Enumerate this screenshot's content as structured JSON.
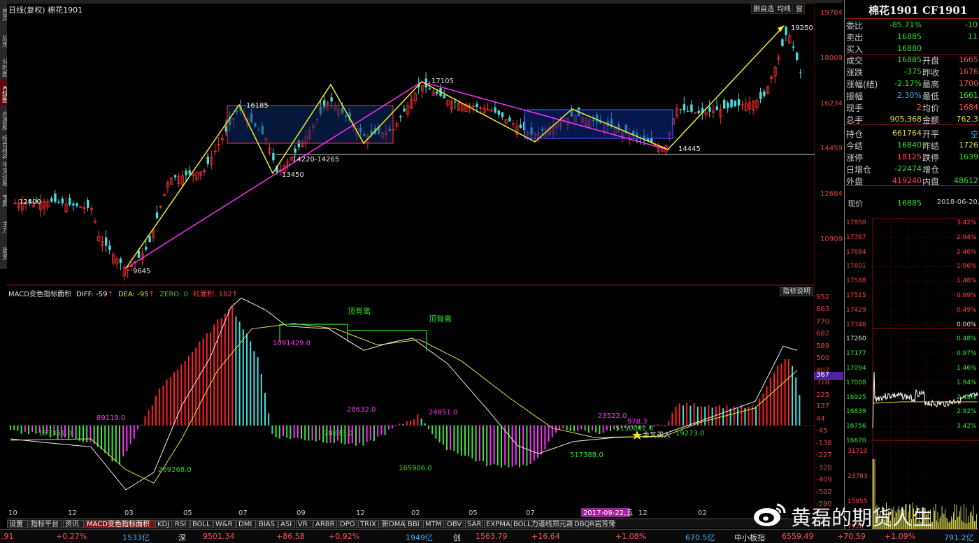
{
  "main_chart": {
    "title": "日线(复权) 棉花1901",
    "toolbar": {
      "btn1": "删自选",
      "btn2": "均线",
      "btn3": "窗"
    },
    "price_axis": [
      "19784",
      "18009",
      "16234",
      "14459",
      "12684",
      "10909"
    ],
    "annotations": {
      "high_2018": "19250",
      "high_a": "16185",
      "high_b": "17105",
      "low_a": "13450",
      "range_label": "14220-14265",
      "low_c": "14445",
      "start_price": "12400",
      "low_2016": "9645"
    }
  },
  "macd": {
    "header": {
      "name": "MACD变色指标面积",
      "diff_label": "DIFF: -59",
      "dea_label": "DEA: -95",
      "zero_label": "ZERO: 0",
      "red_area_label": "红面积: 182",
      "arrow": "↑"
    },
    "help_button": "指标说明",
    "axis": [
      "952",
      "863",
      "770",
      "682",
      "589",
      "500",
      "407",
      "318",
      "225",
      "137",
      "44",
      "-45",
      "-138",
      "-227",
      "-320",
      "-409",
      "-502",
      "-590"
    ],
    "current_value": "367",
    "divergence_labels": [
      "顶背离",
      "顶背离"
    ],
    "area_labels": {
      "a1": "1091429.0",
      "a2": "89119.0",
      "a3": "153351.0",
      "a4": "28632.0",
      "a5": "24851.0",
      "a6": "78833.0",
      "a7": "269268.0",
      "a8": "165906.0",
      "a9": "23522.0",
      "a10": "5150002.0",
      "a11": "19273.0",
      "a12": "517388.0",
      "a13": "978.3"
    },
    "signal_label": "金叉买入"
  },
  "time_axis": {
    "labels": [
      "10",
      "12",
      "03",
      "05",
      "07",
      "09",
      "12",
      "02",
      "05",
      "07",
      "2017-09-22,五",
      "12",
      "02"
    ]
  },
  "indicator_tabs": [
    "设置",
    "指标平台",
    "资讯",
    "MACD变色指标面积",
    "KDJ",
    "RSI",
    "BOLL",
    "W&R",
    "DMI",
    "BIAS",
    "ASI",
    "VR",
    "ARBR",
    "DPO",
    "TRIX",
    "新DMA",
    "BBI",
    "MTM",
    "OBV",
    "SAR",
    "EXPMA",
    "BOLL力道线郑元凯",
    "DBQR岩芳荣"
  ],
  "status_bar": [
    {
      "text": ".91",
      "color": "#ff5050"
    },
    {
      "text": "+0.27%",
      "color": "#ff5050"
    },
    {
      "text": "1533亿",
      "color": "#40b0ff"
    },
    {
      "text": "深",
      "color": "#ddd"
    },
    {
      "text": "9501.34",
      "color": "#ff5050"
    },
    {
      "text": "+86.58",
      "color": "#ff5050"
    },
    {
      "text": "+0.92%",
      "color": "#ff5050"
    },
    {
      "text": "1949亿",
      "color": "#40b0ff"
    },
    {
      "text": "创",
      "color": "#ddd"
    },
    {
      "text": "1563.79",
      "color": "#ff5050"
    },
    {
      "text": "+16.64",
      "color": "#ff5050"
    },
    {
      "text": "+1.08%",
      "color": "#ff5050"
    },
    {
      "text": "670.5亿",
      "color": "#40b0ff"
    },
    {
      "text": "中小板指",
      "color": "#ddd"
    },
    {
      "text": "6559.49",
      "color": "#ff5050"
    },
    {
      "text": "+70.59",
      "color": "#ff5050"
    },
    {
      "text": "+1.09%",
      "color": "#ff5050"
    },
    {
      "text": "791.2亿",
      "color": "#40b0ff"
    }
  ],
  "right_panel": {
    "title": "棉花1901 CF1901",
    "rows": [
      {
        "l": "委比",
        "v": "-85.71%",
        "v2": "-10",
        "c": "#30e030"
      },
      {
        "l": "卖出",
        "v": "16885",
        "v2": "11",
        "c": "#30e030"
      },
      {
        "l": "买入",
        "v": "16880",
        "v2": "",
        "c": "#30e030"
      }
    ],
    "grid": [
      {
        "l": "成交",
        "v": "16885",
        "c": "#30e030",
        "l2": "开盘",
        "v2": "1665",
        "c2": "#ff5050"
      },
      {
        "l": "涨跌",
        "v": "-375",
        "c": "#30e030",
        "l2": "昨收",
        "v2": "1676",
        "c2": "#ff5050"
      },
      {
        "l": "涨幅(结)",
        "v": "-2.17%",
        "c": "#30e030",
        "l2": "最高",
        "v2": "1700",
        "c2": "#ff5050"
      },
      {
        "l": "振幅",
        "v": "2.30%",
        "c": "#40b0ff",
        "l2": "最低",
        "v2": "1661",
        "c2": "#30e030"
      },
      {
        "l": "现手",
        "v": "2",
        "c": "#ff5050",
        "l2": "均价",
        "v2": "1684",
        "c2": "#ff5050"
      },
      {
        "l": "总手",
        "v": "905,368",
        "c": "#dddd40",
        "l2": "金额",
        "v2": "762.3",
        "c2": "#dddd40"
      },
      {
        "l": "持仓",
        "v": "661764",
        "c": "#dddd40",
        "l2": "开平",
        "v2": "空",
        "c2": "#40b0ff"
      },
      {
        "l": "今结",
        "v": "16840",
        "c": "#30e030",
        "l2": "昨结",
        "v2": "1726",
        "c2": "#dddd40"
      },
      {
        "l": "涨停",
        "v": "18125",
        "c": "#ff5050",
        "l2": "跌停",
        "v2": "1639",
        "c2": "#30e030"
      },
      {
        "l": "日增仓",
        "v": "-22474",
        "c": "#30e030",
        "l2": "增仓",
        "v2": "",
        "c2": "#30e030"
      },
      {
        "l": "外盘",
        "v": "419240",
        "c": "#ff5050",
        "l2": "内盘",
        "v2": "48612",
        "c2": "#30e030"
      }
    ],
    "mini_header": {
      "label": "现价",
      "price": "16885",
      "date": "2018-06-20,"
    },
    "mini_left_axis": [
      "17850",
      "17767",
      "17684",
      "17601",
      "17588",
      "17515",
      "17429",
      "17346",
      "17260",
      "17177",
      "17094",
      "17008",
      "16925",
      "16839",
      "16756",
      "16670"
    ],
    "mini_right_axis": [
      "3.42%",
      "2.94%",
      "2.46%",
      "1.96%",
      "1.48%",
      "0.99%",
      "0.49%",
      "0.00%",
      "0.48%",
      "0.97%",
      "1.46%",
      "1.94%",
      "2.44%",
      "2.92%",
      "3.42%"
    ],
    "vol_axis": [
      "31710",
      "23783",
      "15855",
      "7928"
    ]
  },
  "watermark": {
    "text": "黄磊的期货人生"
  },
  "left_tabs": [
    "首页",
    "应用",
    "分时图",
    "K线图",
    "自选股",
    "综合排名",
    "牛叉诊股",
    "宝典",
    "主力",
    "更多"
  ]
}
